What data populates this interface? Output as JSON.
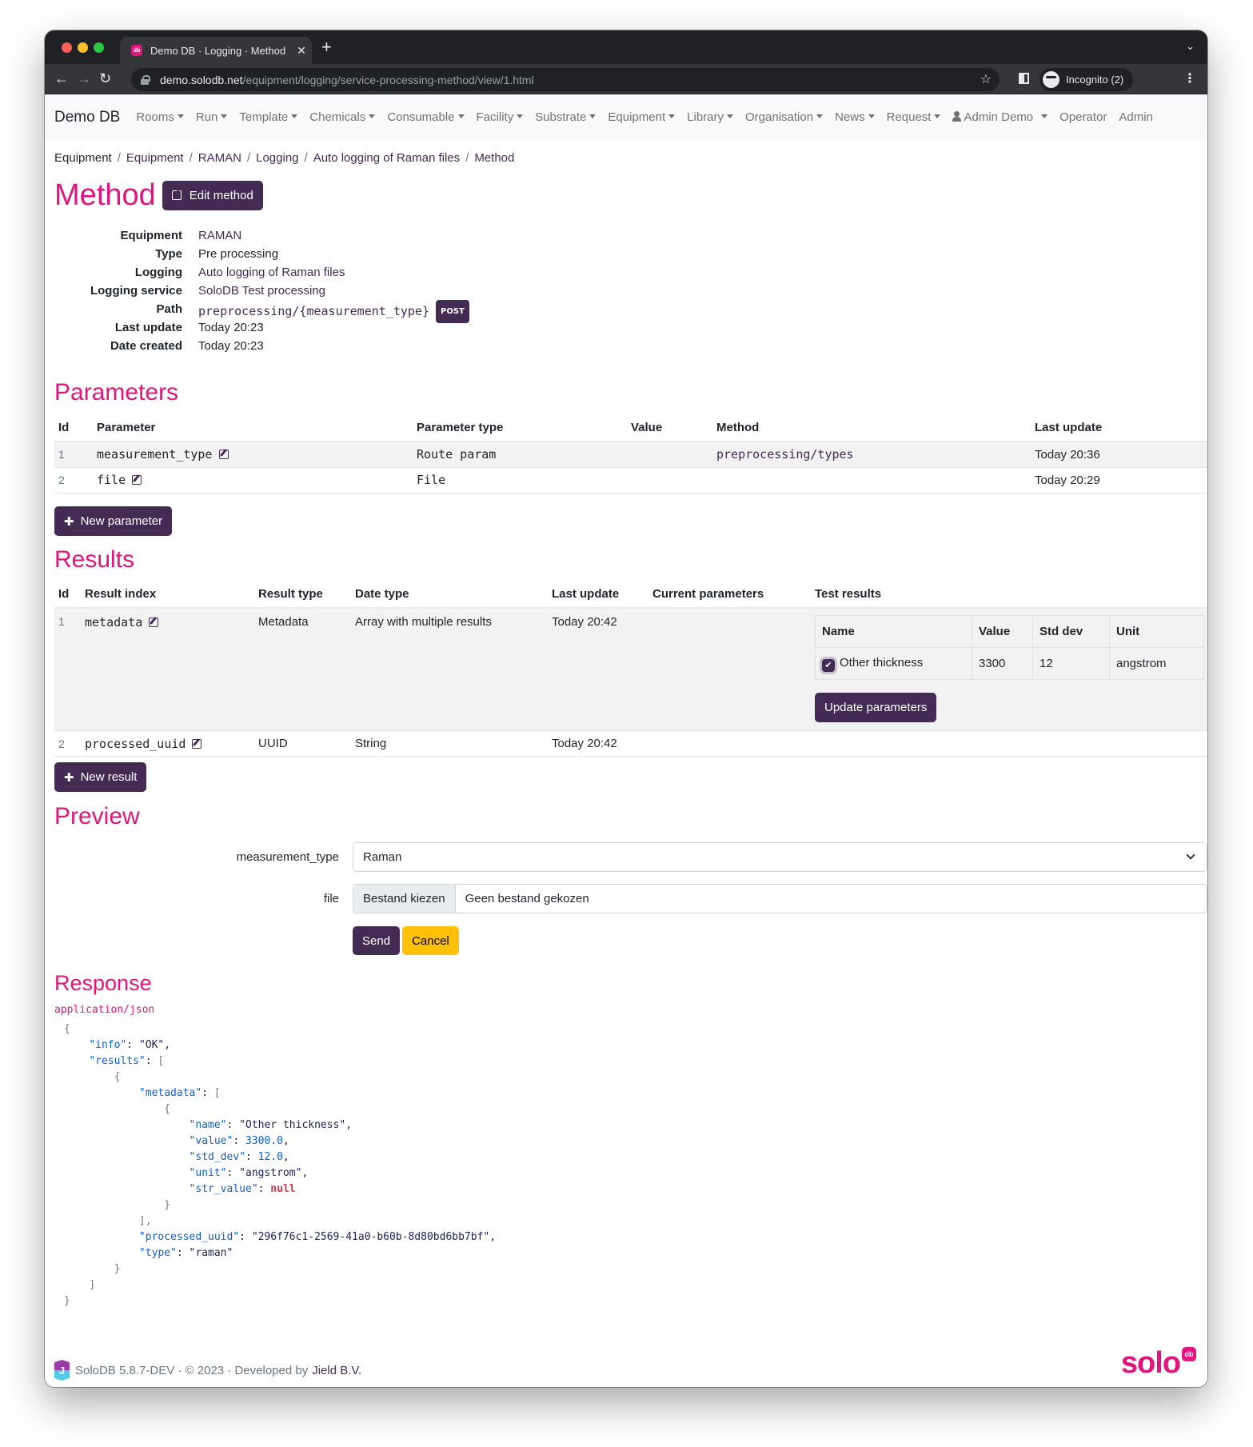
{
  "browser": {
    "tab_title": "Demo DB · Logging · Method",
    "tab_favicon": "db",
    "url_host": "demo.solodb.net",
    "url_path": "/equipment/logging/service-processing-method/view/1.html",
    "incognito_label": "Incognito (2)",
    "icons": {
      "back": "←",
      "forward": "→",
      "reload": "↻",
      "star": "☆",
      "close": "✕",
      "new_tab": "+",
      "menu": "⋮",
      "tab_menu": "⌄"
    }
  },
  "navbar": {
    "brand": "Demo DB",
    "items": [
      {
        "label": "Rooms",
        "dropdown": true
      },
      {
        "label": "Run",
        "dropdown": true
      },
      {
        "label": "Template",
        "dropdown": true
      },
      {
        "label": "Chemicals",
        "dropdown": true
      },
      {
        "label": "Consumable",
        "dropdown": true
      },
      {
        "label": "Facility",
        "dropdown": true
      },
      {
        "label": "Substrate",
        "dropdown": true
      },
      {
        "label": "Equipment",
        "dropdown": true
      },
      {
        "label": "Library",
        "dropdown": true
      },
      {
        "label": "Organisation",
        "dropdown": true
      },
      {
        "label": "News",
        "dropdown": true
      },
      {
        "label": "Request",
        "dropdown": true
      }
    ],
    "user": "Admin Demo",
    "operator": "Operator",
    "admin": "Admin"
  },
  "breadcrumb": [
    "Equipment",
    "Equipment",
    "RAMAN",
    "Logging",
    "Auto logging of Raman files",
    "Method"
  ],
  "method": {
    "title": "Method",
    "edit_label": "Edit method",
    "props": [
      {
        "label": "Equipment",
        "value": "RAMAN",
        "link": true
      },
      {
        "label": "Type",
        "value": "Pre processing"
      },
      {
        "label": "Logging",
        "value": "Auto logging of Raman files",
        "link": true
      },
      {
        "label": "Logging service",
        "value": "SoloDB Test processing",
        "link": true
      },
      {
        "label": "Path",
        "value": "preprocessing/{measurement_type}",
        "badge": "POST"
      },
      {
        "label": "Last update",
        "value": "Today 20:23"
      },
      {
        "label": "Date created",
        "value": "Today 20:23"
      }
    ]
  },
  "parameters": {
    "title": "Parameters",
    "columns": [
      "Id",
      "Parameter",
      "Parameter type",
      "Value",
      "Method",
      "Last update"
    ],
    "rows": [
      {
        "id": "1",
        "parameter": "measurement_type",
        "type": "Route param",
        "value": "",
        "method": "preprocessing/types",
        "last_update": "Today 20:36"
      },
      {
        "id": "2",
        "parameter": "file",
        "type": "File",
        "value": "",
        "method": "",
        "last_update": "Today 20:29"
      }
    ],
    "new_label": "New parameter"
  },
  "results": {
    "title": "Results",
    "columns": [
      "Id",
      "Result index",
      "Result type",
      "Date type",
      "Last update",
      "Current parameters",
      "Test results"
    ],
    "rows": [
      {
        "id": "1",
        "index": "metadata",
        "type": "Metadata",
        "date_type": "Array with multiple results",
        "last_update": "Today 20:42",
        "current_parameters": ""
      },
      {
        "id": "2",
        "index": "processed_uuid",
        "type": "UUID",
        "date_type": "String",
        "last_update": "Today 20:42",
        "current_parameters": ""
      }
    ],
    "test_results": {
      "columns": [
        "Name",
        "Value",
        "Std dev",
        "Unit"
      ],
      "rows": [
        {
          "checked": true,
          "name": "Other thickness",
          "value": "3300",
          "std_dev": "12",
          "unit": "angstrom"
        }
      ],
      "update_label": "Update parameters"
    },
    "new_label": "New result"
  },
  "preview": {
    "title": "Preview",
    "fields": {
      "measurement_type_label": "measurement_type",
      "measurement_type_value": "Raman",
      "file_label": "file",
      "file_button": "Bestand kiezen",
      "file_value": "Geen bestand gekozen"
    },
    "send_label": "Send",
    "cancel_label": "Cancel"
  },
  "response": {
    "title": "Response",
    "content_type": "application/json",
    "body": {
      "info": "\"OK\"",
      "name": "\"Other thickness\"",
      "value": "3300.0",
      "std_dev": "12.0",
      "unit": "\"angstrom\"",
      "str_value": "null",
      "processed_uuid": "\"296f76c1-2569-41a0-b60b-8d80bd6bb7bf\"",
      "type": "\"raman\""
    }
  },
  "footer": {
    "text": "SoloDB 5.8.7-DEV · © 2023 · Developed by",
    "developer": "Jield B.V.",
    "logo_text": "solo",
    "logo_badge": "db"
  },
  "colors": {
    "accent_pink": "#e0157e",
    "primary_purple": "#432b54",
    "warning_yellow": "#ffc107"
  }
}
